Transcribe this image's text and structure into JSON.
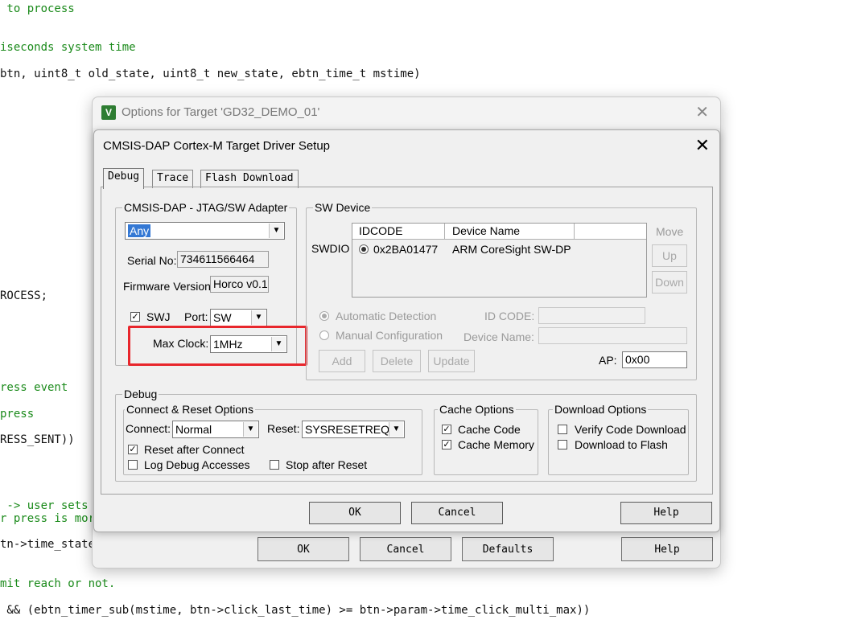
{
  "code_lines": [
    {
      "text": " to process",
      "cls": "cm"
    },
    {
      "text": "iseconds system time",
      "cls": "cm"
    },
    {
      "text": "btn, uint8_t old_state, uint8_t new_state, ebtn_time_t mstime)",
      "cls": "tx"
    },
    {
      "text": "ROCESS;",
      "cls": "tx"
    },
    {
      "text": "ress event",
      "cls": "cm"
    },
    {
      "text": "press",
      "cls": "cm"
    },
    {
      "text": "RESS_SENT))",
      "cls": "tx"
    },
    {
      "text": " -> user sets",
      "cls": "cm"
    },
    {
      "text": "r press is mor",
      "cls": "cm"
    },
    {
      "text": "tn->time_state",
      "cls": "tx"
    },
    {
      "text": "mit reach or not.",
      "cls": "cm"
    },
    {
      "text": " && (ebtn_timer_sub(mstime, btn->click_last_time) >= btn->param->time_click_multi_max))",
      "cls": "tx"
    }
  ],
  "outer_window": {
    "title": "Options for Target 'GD32_DEMO_01'",
    "buttons": {
      "ok": "OK",
      "cancel": "Cancel",
      "defaults": "Defaults",
      "help": "Help"
    }
  },
  "dialog": {
    "title": "CMSIS-DAP Cortex-M Target Driver Setup",
    "tabs": [
      "Debug",
      "Trace",
      "Flash Download"
    ],
    "adapter": {
      "group_label": "CMSIS-DAP - JTAG/SW Adapter",
      "selected": "Any",
      "serial_label": "Serial No:",
      "serial_value": "734611566464",
      "firmware_label": "Firmware Version:",
      "firmware_value": "Horco v0.1",
      "swj_label": "SWJ",
      "swj_checked": true,
      "port_label": "Port:",
      "port_value": "SW",
      "max_clock_label": "Max Clock:",
      "max_clock_value": "1MHz"
    },
    "sw_device": {
      "group_label": "SW Device",
      "swdio_label": "SWDIO",
      "col_idcode": "IDCODE",
      "col_device_name": "Device Name",
      "rows": [
        {
          "idcode": "0x2BA01477",
          "device_name": "ARM CoreSight SW-DP"
        }
      ],
      "move_label": "Move",
      "up_label": "Up",
      "down_label": "Down",
      "auto_detect_label": "Automatic Detection",
      "manual_config_label": "Manual Configuration",
      "id_code_label": "ID CODE:",
      "device_name_label": "Device Name:",
      "add_label": "Add",
      "delete_label": "Delete",
      "update_label": "Update",
      "ap_label": "AP:",
      "ap_value": "0x00"
    },
    "debug": {
      "group_label": "Debug",
      "connect_reset": {
        "group_label": "Connect & Reset Options",
        "connect_label": "Connect:",
        "connect_value": "Normal",
        "reset_label": "Reset:",
        "reset_value": "SYSRESETREQ",
        "reset_after_connect": "Reset after Connect",
        "log_debug_accesses": "Log Debug Accesses",
        "stop_after_reset": "Stop after Reset"
      },
      "cache": {
        "group_label": "Cache Options",
        "cache_code": "Cache Code",
        "cache_memory": "Cache Memory"
      },
      "download": {
        "group_label": "Download Options",
        "verify_code_download": "Verify Code Download",
        "download_to_flash": "Download to Flash"
      }
    },
    "buttons": {
      "ok": "OK",
      "cancel": "Cancel",
      "help": "Help"
    }
  },
  "colors": {
    "highlight": "#e8262c",
    "comment": "#1a8a1a",
    "selection": "#3478d4"
  }
}
